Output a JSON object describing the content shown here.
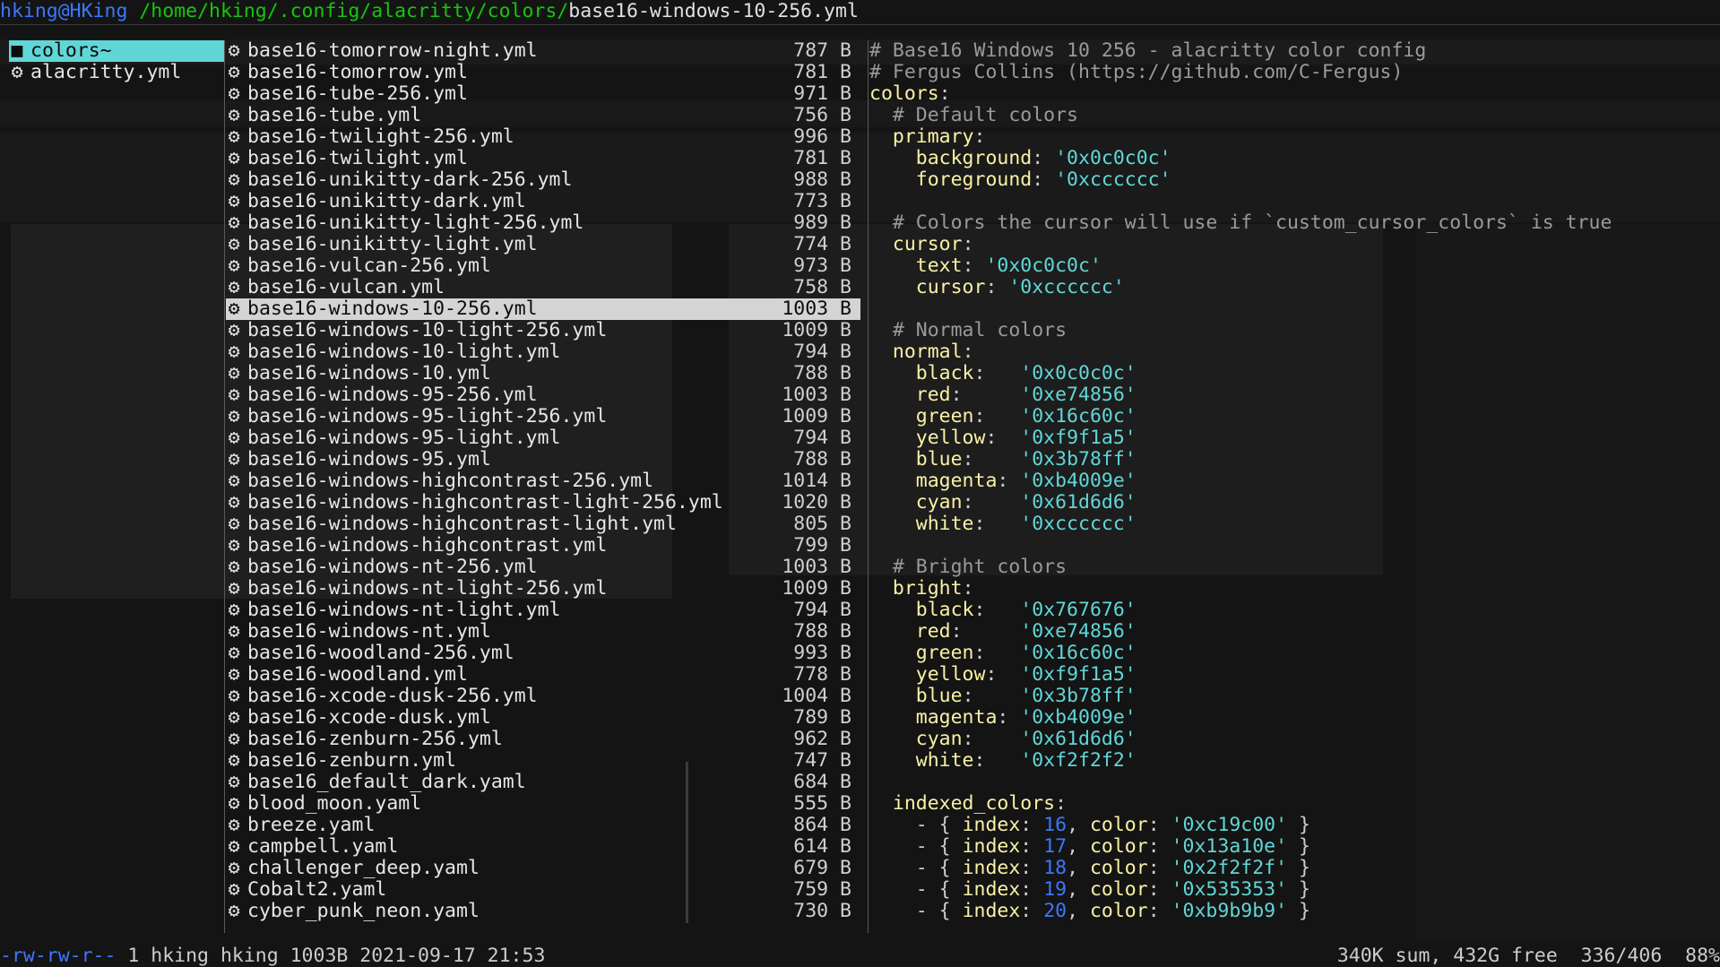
{
  "titlebar": {
    "user_host": "hking@HKing",
    "dir_path": " /home/hking/.config/alacritty/colors/",
    "file_name": "base16-windows-10-256.yml"
  },
  "left_pane": {
    "items": [
      {
        "icon": "folder-icon",
        "glyph": "■",
        "label": "colors~",
        "selected": true
      },
      {
        "icon": "gear-icon",
        "glyph": "⚙",
        "label": "alacritty.yml",
        "selected": false
      }
    ]
  },
  "files": [
    {
      "name": "base16-tomorrow-night.yml",
      "size": "787 B"
    },
    {
      "name": "base16-tomorrow.yml",
      "size": "781 B"
    },
    {
      "name": "base16-tube-256.yml",
      "size": "971 B"
    },
    {
      "name": "base16-tube.yml",
      "size": "756 B"
    },
    {
      "name": "base16-twilight-256.yml",
      "size": "996 B"
    },
    {
      "name": "base16-twilight.yml",
      "size": "781 B"
    },
    {
      "name": "base16-unikitty-dark-256.yml",
      "size": "988 B"
    },
    {
      "name": "base16-unikitty-dark.yml",
      "size": "773 B"
    },
    {
      "name": "base16-unikitty-light-256.yml",
      "size": "989 B"
    },
    {
      "name": "base16-unikitty-light.yml",
      "size": "774 B"
    },
    {
      "name": "base16-vulcan-256.yml",
      "size": "973 B"
    },
    {
      "name": "base16-vulcan.yml",
      "size": "758 B"
    },
    {
      "name": "base16-windows-10-256.yml",
      "size": "1003 B",
      "selected": true
    },
    {
      "name": "base16-windows-10-light-256.yml",
      "size": "1009 B"
    },
    {
      "name": "base16-windows-10-light.yml",
      "size": "794 B"
    },
    {
      "name": "base16-windows-10.yml",
      "size": "788 B"
    },
    {
      "name": "base16-windows-95-256.yml",
      "size": "1003 B"
    },
    {
      "name": "base16-windows-95-light-256.yml",
      "size": "1009 B"
    },
    {
      "name": "base16-windows-95-light.yml",
      "size": "794 B"
    },
    {
      "name": "base16-windows-95.yml",
      "size": "788 B"
    },
    {
      "name": "base16-windows-highcontrast-256.yml",
      "size": "1014 B"
    },
    {
      "name": "base16-windows-highcontrast-light-256.yml",
      "size": "1020 B"
    },
    {
      "name": "base16-windows-highcontrast-light.yml",
      "size": "805 B"
    },
    {
      "name": "base16-windows-highcontrast.yml",
      "size": "799 B"
    },
    {
      "name": "base16-windows-nt-256.yml",
      "size": "1003 B"
    },
    {
      "name": "base16-windows-nt-light-256.yml",
      "size": "1009 B"
    },
    {
      "name": "base16-windows-nt-light.yml",
      "size": "794 B"
    },
    {
      "name": "base16-windows-nt.yml",
      "size": "788 B"
    },
    {
      "name": "base16-woodland-256.yml",
      "size": "993 B"
    },
    {
      "name": "base16-woodland.yml",
      "size": "778 B"
    },
    {
      "name": "base16-xcode-dusk-256.yml",
      "size": "1004 B"
    },
    {
      "name": "base16-xcode-dusk.yml",
      "size": "789 B"
    },
    {
      "name": "base16-zenburn-256.yml",
      "size": "962 B"
    },
    {
      "name": "base16-zenburn.yml",
      "size": "747 B"
    },
    {
      "name": "base16_default_dark.yaml",
      "size": "684 B"
    },
    {
      "name": "blood_moon.yaml",
      "size": "555 B"
    },
    {
      "name": "breeze.yaml",
      "size": "864 B"
    },
    {
      "name": "campbell.yaml",
      "size": "614 B"
    },
    {
      "name": "challenger_deep.yaml",
      "size": "679 B"
    },
    {
      "name": "Cobalt2.yaml",
      "size": "759 B"
    },
    {
      "name": "cyber_punk_neon.yaml",
      "size": "730 B"
    }
  ],
  "preview": {
    "lines": [
      [
        {
          "t": "# Base16 Windows 10 256 - alacritty color config",
          "c": "com"
        }
      ],
      [
        {
          "t": "# Fergus Collins (https://github.com/C-Fergus)",
          "c": "com"
        }
      ],
      [
        {
          "t": "colors",
          "c": "key"
        },
        {
          "t": ":",
          "c": "pun"
        }
      ],
      [
        {
          "t": "  # Default colors",
          "c": "com"
        }
      ],
      [
        {
          "t": "  primary",
          "c": "key"
        },
        {
          "t": ":",
          "c": "pun"
        }
      ],
      [
        {
          "t": "    background",
          "c": "key"
        },
        {
          "t": ": ",
          "c": "pun"
        },
        {
          "t": "'0x0c0c0c'",
          "c": "str"
        }
      ],
      [
        {
          "t": "    foreground",
          "c": "key"
        },
        {
          "t": ": ",
          "c": "pun"
        },
        {
          "t": "'0xcccccc'",
          "c": "str"
        }
      ],
      [
        {
          "t": "",
          "c": "pun"
        }
      ],
      [
        {
          "t": "  # Colors the cursor will use if `custom_cursor_colors` is true",
          "c": "com"
        }
      ],
      [
        {
          "t": "  cursor",
          "c": "key"
        },
        {
          "t": ":",
          "c": "pun"
        }
      ],
      [
        {
          "t": "    text",
          "c": "key"
        },
        {
          "t": ": ",
          "c": "pun"
        },
        {
          "t": "'0x0c0c0c'",
          "c": "str"
        }
      ],
      [
        {
          "t": "    cursor",
          "c": "key"
        },
        {
          "t": ": ",
          "c": "pun"
        },
        {
          "t": "'0xcccccc'",
          "c": "str"
        }
      ],
      [
        {
          "t": "",
          "c": "pun"
        }
      ],
      [
        {
          "t": "  # Normal colors",
          "c": "com"
        }
      ],
      [
        {
          "t": "  normal",
          "c": "key"
        },
        {
          "t": ":",
          "c": "pun"
        }
      ],
      [
        {
          "t": "    black",
          "c": "key"
        },
        {
          "t": ":   ",
          "c": "pun"
        },
        {
          "t": "'0x0c0c0c'",
          "c": "str"
        }
      ],
      [
        {
          "t": "    red",
          "c": "key"
        },
        {
          "t": ":     ",
          "c": "pun"
        },
        {
          "t": "'0xe74856'",
          "c": "str"
        }
      ],
      [
        {
          "t": "    green",
          "c": "key"
        },
        {
          "t": ":   ",
          "c": "pun"
        },
        {
          "t": "'0x16c60c'",
          "c": "str"
        }
      ],
      [
        {
          "t": "    yellow",
          "c": "key"
        },
        {
          "t": ":  ",
          "c": "pun"
        },
        {
          "t": "'0xf9f1a5'",
          "c": "str"
        }
      ],
      [
        {
          "t": "    blue",
          "c": "key"
        },
        {
          "t": ":    ",
          "c": "pun"
        },
        {
          "t": "'0x3b78ff'",
          "c": "str"
        }
      ],
      [
        {
          "t": "    magenta",
          "c": "key"
        },
        {
          "t": ": ",
          "c": "pun"
        },
        {
          "t": "'0xb4009e'",
          "c": "str"
        }
      ],
      [
        {
          "t": "    cyan",
          "c": "key"
        },
        {
          "t": ":    ",
          "c": "pun"
        },
        {
          "t": "'0x61d6d6'",
          "c": "str"
        }
      ],
      [
        {
          "t": "    white",
          "c": "key"
        },
        {
          "t": ":   ",
          "c": "pun"
        },
        {
          "t": "'0xcccccc'",
          "c": "str"
        }
      ],
      [
        {
          "t": "",
          "c": "pun"
        }
      ],
      [
        {
          "t": "  # Bright colors",
          "c": "com"
        }
      ],
      [
        {
          "t": "  bright",
          "c": "key"
        },
        {
          "t": ":",
          "c": "pun"
        }
      ],
      [
        {
          "t": "    black",
          "c": "key"
        },
        {
          "t": ":   ",
          "c": "pun"
        },
        {
          "t": "'0x767676'",
          "c": "str"
        }
      ],
      [
        {
          "t": "    red",
          "c": "key"
        },
        {
          "t": ":     ",
          "c": "pun"
        },
        {
          "t": "'0xe74856'",
          "c": "str"
        }
      ],
      [
        {
          "t": "    green",
          "c": "key"
        },
        {
          "t": ":   ",
          "c": "pun"
        },
        {
          "t": "'0x16c60c'",
          "c": "str"
        }
      ],
      [
        {
          "t": "    yellow",
          "c": "key"
        },
        {
          "t": ":  ",
          "c": "pun"
        },
        {
          "t": "'0xf9f1a5'",
          "c": "str"
        }
      ],
      [
        {
          "t": "    blue",
          "c": "key"
        },
        {
          "t": ":    ",
          "c": "pun"
        },
        {
          "t": "'0x3b78ff'",
          "c": "str"
        }
      ],
      [
        {
          "t": "    magenta",
          "c": "key"
        },
        {
          "t": ": ",
          "c": "pun"
        },
        {
          "t": "'0xb4009e'",
          "c": "str"
        }
      ],
      [
        {
          "t": "    cyan",
          "c": "key"
        },
        {
          "t": ":    ",
          "c": "pun"
        },
        {
          "t": "'0x61d6d6'",
          "c": "str"
        }
      ],
      [
        {
          "t": "    white",
          "c": "key"
        },
        {
          "t": ":   ",
          "c": "pun"
        },
        {
          "t": "'0xf2f2f2'",
          "c": "str"
        }
      ],
      [
        {
          "t": "",
          "c": "pun"
        }
      ],
      [
        {
          "t": "  indexed_colors",
          "c": "key"
        },
        {
          "t": ":",
          "c": "pun"
        }
      ],
      [
        {
          "t": "    - { ",
          "c": "pun"
        },
        {
          "t": "index",
          "c": "key"
        },
        {
          "t": ": ",
          "c": "pun"
        },
        {
          "t": "16",
          "c": "num"
        },
        {
          "t": ", ",
          "c": "pun"
        },
        {
          "t": "color",
          "c": "key"
        },
        {
          "t": ": ",
          "c": "pun"
        },
        {
          "t": "'0xc19c00'",
          "c": "str"
        },
        {
          "t": " }",
          "c": "pun"
        }
      ],
      [
        {
          "t": "    - { ",
          "c": "pun"
        },
        {
          "t": "index",
          "c": "key"
        },
        {
          "t": ": ",
          "c": "pun"
        },
        {
          "t": "17",
          "c": "num"
        },
        {
          "t": ", ",
          "c": "pun"
        },
        {
          "t": "color",
          "c": "key"
        },
        {
          "t": ": ",
          "c": "pun"
        },
        {
          "t": "'0x13a10e'",
          "c": "str"
        },
        {
          "t": " }",
          "c": "pun"
        }
      ],
      [
        {
          "t": "    - { ",
          "c": "pun"
        },
        {
          "t": "index",
          "c": "key"
        },
        {
          "t": ": ",
          "c": "pun"
        },
        {
          "t": "18",
          "c": "num"
        },
        {
          "t": ", ",
          "c": "pun"
        },
        {
          "t": "color",
          "c": "key"
        },
        {
          "t": ": ",
          "c": "pun"
        },
        {
          "t": "'0x2f2f2f'",
          "c": "str"
        },
        {
          "t": " }",
          "c": "pun"
        }
      ],
      [
        {
          "t": "    - { ",
          "c": "pun"
        },
        {
          "t": "index",
          "c": "key"
        },
        {
          "t": ": ",
          "c": "pun"
        },
        {
          "t": "19",
          "c": "num"
        },
        {
          "t": ", ",
          "c": "pun"
        },
        {
          "t": "color",
          "c": "key"
        },
        {
          "t": ": ",
          "c": "pun"
        },
        {
          "t": "'0x535353'",
          "c": "str"
        },
        {
          "t": " }",
          "c": "pun"
        }
      ],
      [
        {
          "t": "    - { ",
          "c": "pun"
        },
        {
          "t": "index",
          "c": "key"
        },
        {
          "t": ": ",
          "c": "pun"
        },
        {
          "t": "20",
          "c": "num"
        },
        {
          "t": ", ",
          "c": "pun"
        },
        {
          "t": "color",
          "c": "key"
        },
        {
          "t": ": ",
          "c": "pun"
        },
        {
          "t": "'0xb9b9b9'",
          "c": "str"
        },
        {
          "t": " }",
          "c": "pun"
        }
      ]
    ]
  },
  "status": {
    "permissions": "-rw-rw-r--",
    "info": " 1 hking hking 1003B 2021-09-17 21:53",
    "summary": "340K sum, 432G free  336/406  88%"
  },
  "colors": {
    "selection_dir": "#61d6d6",
    "selection_file": "#d4d4d4",
    "path_green": "#16c60c",
    "user_blue": "#3b78ff",
    "yaml_key": "#f9f1a5",
    "yaml_string": "#61d6d6"
  }
}
